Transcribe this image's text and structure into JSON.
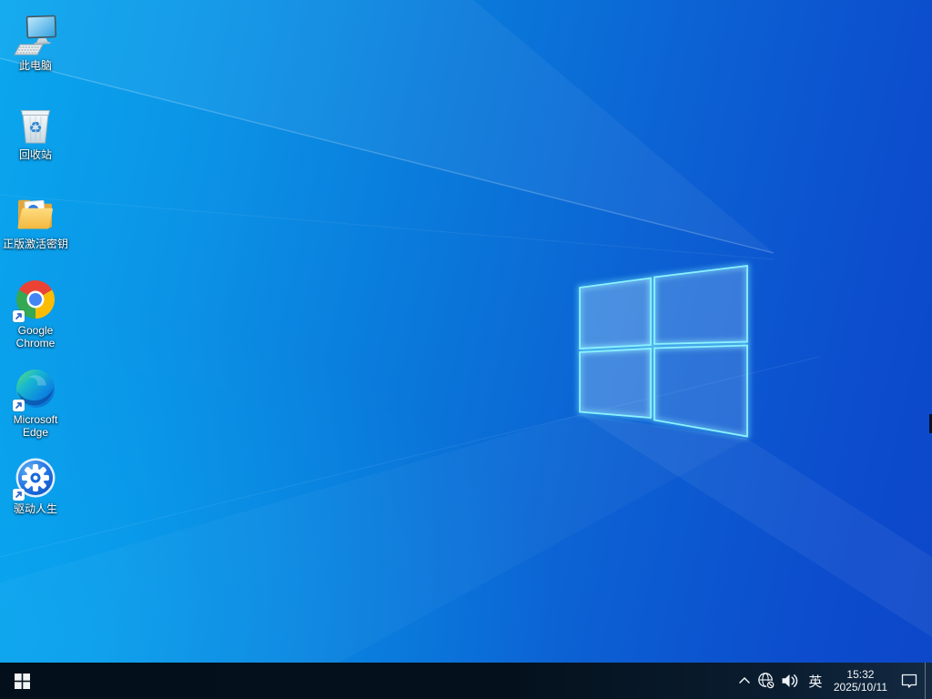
{
  "desktop": {
    "wallpaper": "windows10-default-light-rays",
    "icons": [
      {
        "label": "此电脑",
        "name": "this-pc",
        "shortcut": false
      },
      {
        "label": "回收站",
        "name": "recycle-bin",
        "shortcut": false
      },
      {
        "label": "正版激活密钥",
        "name": "activation-key-folder",
        "shortcut": false
      },
      {
        "label": "Google Chrome",
        "name": "google-chrome",
        "shortcut": true
      },
      {
        "label": "Microsoft Edge",
        "name": "microsoft-edge",
        "shortcut": true
      },
      {
        "label": "驱动人生",
        "name": "driver-life",
        "shortcut": true
      }
    ]
  },
  "taskbar": {
    "start": {
      "tooltip": "开始"
    },
    "tray": {
      "language_indicator": "英",
      "time": "15:32",
      "date": "2025/10/11"
    },
    "icons": [
      "hidden-icons-chevron",
      "network-globe-offline",
      "volume",
      "language",
      "clock",
      "action-center",
      "show-desktop"
    ]
  },
  "colors": {
    "wallpaper_left": "#0aa7ee",
    "wallpaper_right": "#0d47c9",
    "logo_pane_stroke": "#85f0ff",
    "taskbar_bg": "#04111d",
    "icon_label_text": "#ffffff",
    "chrome_red": "#ea4335",
    "chrome_yellow": "#fbbc05",
    "chrome_green": "#34a853",
    "chrome_blue": "#4285f4",
    "edge_gradient": [
      "#5fe26f",
      "#18b8cf",
      "#0c86e0",
      "#0f5fc0"
    ],
    "folder_yellow": "#ffd977",
    "driver_life_blue": "#1668d8"
  }
}
